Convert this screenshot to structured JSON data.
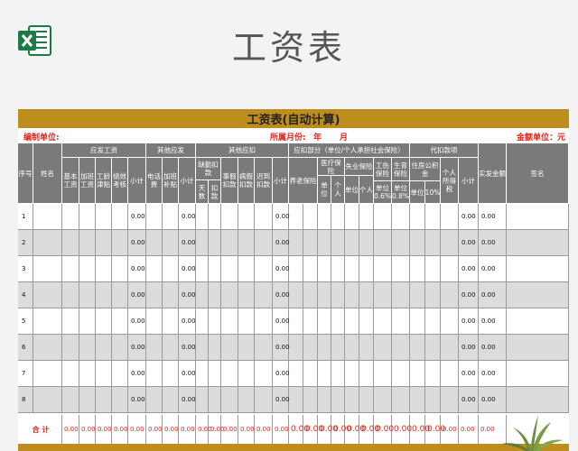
{
  "page_title": "工资表",
  "sheet": {
    "title": "工资表(自动计算)",
    "unit_label": "编制单位:",
    "month_label": "所属月份:",
    "year_label": "年",
    "mon_label": "月",
    "currency_label": "金额单位：元"
  },
  "headers": {
    "seq": "序号",
    "name": "姓名",
    "payable_group": "应发工资",
    "base": "基本工资",
    "overtime": "加班工资",
    "seniority": "工龄津贴",
    "performance": "绩效考核",
    "subtotal": "小计",
    "other_pay_group": "其他应发",
    "phone": "电话费",
    "ot_subsidy": "加班补贴",
    "other_ded_group": "其他应扣",
    "absence": "缺勤扣款",
    "absence_days": "天数",
    "absence_amount": "扣款",
    "leave": "事假扣款",
    "sick": "病假扣款",
    "late": "迟到扣款",
    "social_group": "应扣部分（单位/个人承担社会保险）",
    "pension": "养老保险",
    "medical": "医疗保险",
    "unemployment": "失业保险",
    "injury": "工伤保险",
    "maternity": "生育保险",
    "housing": "住房公积金",
    "unit": "单位",
    "personal": "个人",
    "injury_rate": "单位0.6%",
    "maternity_rate": "单位0.8%",
    "housing_rate": "10%",
    "withhold_group": "代扣款项",
    "income_tax": "个人所得税",
    "net_pay": "实发金额",
    "signature": "签名"
  },
  "rows": [
    {
      "seq": "1",
      "payable_subtotal": "0.00",
      "other_subtotal": "0.00",
      "deduct_subtotal": "0.00",
      "withhold_subtotal": "0.00",
      "net": "0.00"
    },
    {
      "seq": "2",
      "payable_subtotal": "0.00",
      "other_subtotal": "0.00",
      "deduct_subtotal": "0.00",
      "withhold_subtotal": "0.00",
      "net": "0.00"
    },
    {
      "seq": "3",
      "payable_subtotal": "0.00",
      "other_subtotal": "0.00",
      "deduct_subtotal": "0.00",
      "withhold_subtotal": "0.00",
      "net": "0.00"
    },
    {
      "seq": "4",
      "payable_subtotal": "0.00",
      "other_subtotal": "0.00",
      "deduct_subtotal": "0.00",
      "withhold_subtotal": "0.00",
      "net": "0.00"
    },
    {
      "seq": "5",
      "payable_subtotal": "0.00",
      "other_subtotal": "0.00",
      "deduct_subtotal": "0.00",
      "withhold_subtotal": "0.00",
      "net": "0.00"
    },
    {
      "seq": "6",
      "payable_subtotal": "0.00",
      "other_subtotal": "0.00",
      "deduct_subtotal": "0.00",
      "withhold_subtotal": "0.00",
      "net": "0.00"
    },
    {
      "seq": "7",
      "payable_subtotal": "0.00",
      "other_subtotal": "0.00",
      "deduct_subtotal": "0.00",
      "withhold_subtotal": "0.00",
      "net": "0.00"
    },
    {
      "seq": "8",
      "payable_subtotal": "0.00",
      "other_subtotal": "0.00",
      "deduct_subtotal": "0.00",
      "withhold_subtotal": "0.00",
      "net": "0.00"
    }
  ],
  "totals": {
    "label": "合 计",
    "zero_small": "0.00",
    "zero_large": "0.00"
  },
  "colors": {
    "gold": "#bd8d1e",
    "header_gray": "#7a7a7a",
    "alt_row": "#dcdcdc",
    "accent_red": "#e0251b",
    "excel_green": "#1d7a45"
  },
  "icons": [
    "excel-icon",
    "plant-decoration"
  ]
}
